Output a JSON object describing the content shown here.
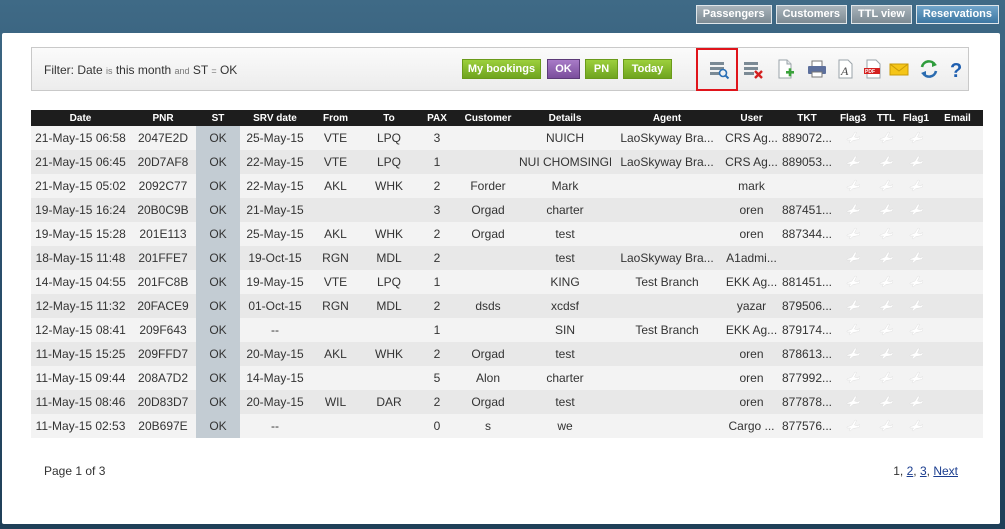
{
  "topnav": [
    {
      "label": "Passengers",
      "active": false
    },
    {
      "label": "Customers",
      "active": false
    },
    {
      "label": "TTL view",
      "active": false
    },
    {
      "label": "Reservations",
      "active": true
    }
  ],
  "filter": {
    "prefix": "Filter: Date ",
    "is": "is",
    "date_value": " this month ",
    "and": "and",
    "st_label": " ST ",
    "eq": "=",
    "st_value": " OK"
  },
  "quick_buttons": {
    "my_bookings": "My bookings",
    "ok": "OK",
    "pn": "PN",
    "today": "Today"
  },
  "toolbar_icons": [
    "search-list-icon",
    "delete-list-icon",
    "add-document-icon",
    "print-icon",
    "font-icon",
    "pdf-icon",
    "email-icon",
    "refresh-icon",
    "help-icon"
  ],
  "table": {
    "headers": [
      "Date",
      "PNR",
      "ST",
      "SRV date",
      "From",
      "To",
      "PAX",
      "Customer",
      "Details",
      "Agent",
      "User",
      "TKT",
      "Flag3",
      "TTL",
      "Flag1",
      "Email"
    ],
    "rows": [
      [
        "21-May-15 06:58",
        "2047E2D",
        "OK",
        "25-May-15",
        "VTE",
        "LPQ",
        "3",
        "",
        "NUICH",
        "LaoSkyway Bra...",
        "CRS Ag...",
        "889072..."
      ],
      [
        "21-May-15 06:45",
        "20D7AF8",
        "OK",
        "22-May-15",
        "VTE",
        "LPQ",
        "1",
        "",
        "NUI CHOMSINGK...",
        "LaoSkyway Bra...",
        "CRS Ag...",
        "889053..."
      ],
      [
        "21-May-15 05:02",
        "2092C77",
        "OK",
        "22-May-15",
        "AKL",
        "WHK",
        "2",
        "Forder",
        "Mark",
        "",
        "mark",
        ""
      ],
      [
        "19-May-15 16:24",
        "20B0C9B",
        "OK",
        "21-May-15",
        "",
        "",
        "3",
        "Orgad",
        "charter",
        "",
        "oren",
        "887451..."
      ],
      [
        "19-May-15 15:28",
        "201E113",
        "OK",
        "25-May-15",
        "AKL",
        "WHK",
        "2",
        "Orgad",
        "test",
        "",
        "oren",
        "887344..."
      ],
      [
        "18-May-15 11:48",
        "201FFE7",
        "OK",
        "19-Oct-15",
        "RGN",
        "MDL",
        "2",
        "",
        "test",
        "LaoSkyway Bra...",
        "A1admi...",
        ""
      ],
      [
        "14-May-15 04:55",
        "201FC8B",
        "OK",
        "19-May-15",
        "VTE",
        "LPQ",
        "1",
        "",
        "KING",
        "Test Branch",
        "EKK Ag...",
        "881451..."
      ],
      [
        "12-May-15 11:32",
        "20FACE9",
        "OK",
        "01-Oct-15",
        "RGN",
        "MDL",
        "2",
        "dsds",
        "xcdsf",
        "",
        "yazar",
        "879506..."
      ],
      [
        "12-May-15 08:41",
        "209F643",
        "OK",
        "--",
        "",
        "",
        "1",
        "",
        "SIN",
        "Test Branch",
        "EKK Ag...",
        "879174..."
      ],
      [
        "11-May-15 15:25",
        "209FFD7",
        "OK",
        "20-May-15",
        "AKL",
        "WHK",
        "2",
        "Orgad",
        "test",
        "",
        "oren",
        "878613..."
      ],
      [
        "11-May-15 09:44",
        "208A7D2",
        "OK",
        "14-May-15",
        "",
        "",
        "5",
        "Alon",
        "charter",
        "",
        "oren",
        "877992..."
      ],
      [
        "11-May-15 08:46",
        "20D83D7",
        "OK",
        "20-May-15",
        "WIL",
        "DAR",
        "2",
        "Orgad",
        "test",
        "",
        "oren",
        "877878..."
      ],
      [
        "11-May-15 02:53",
        "20B697E",
        "OK",
        "--",
        "",
        "",
        "0",
        "s",
        "we",
        "",
        "Cargo ...",
        "877576..."
      ]
    ]
  },
  "footer": {
    "page_info": "Page 1 of 3",
    "pages": [
      "1",
      "2",
      "3"
    ],
    "next": "Next"
  }
}
